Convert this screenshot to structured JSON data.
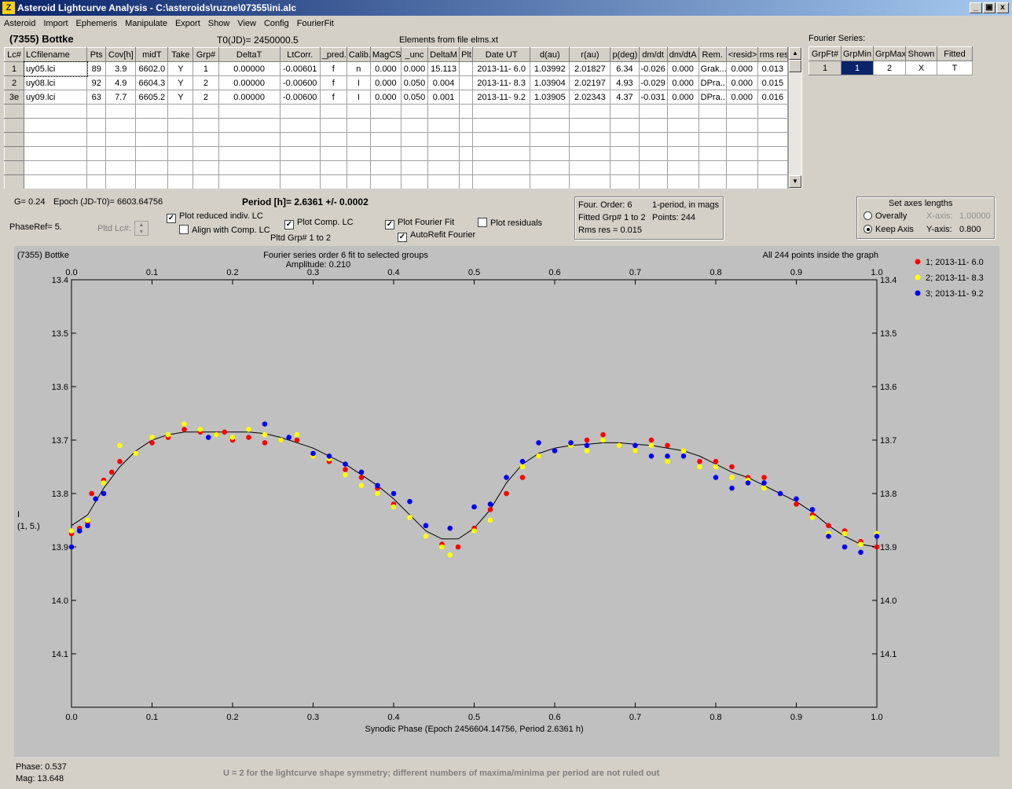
{
  "window": {
    "title": "Asteroid Lightcurve Analysis - C:\\asteroids\\ruzne\\07355\\ini.alc",
    "min": "_",
    "max": "×",
    "close": "x"
  },
  "menu": [
    "Asteroid",
    "Import",
    "Ephemeris",
    "Manipulate",
    "Export",
    "Show",
    "View",
    "Config",
    "FourierFit"
  ],
  "header": {
    "asteroid": "(7355) Bottke",
    "t0": "T0(JD)= 2450000.5",
    "elements": "Elements from file elms.xt"
  },
  "table": {
    "columns": [
      "Lc#",
      "LCfilename",
      "Pts",
      "Cov[h]",
      "midT",
      "Take",
      "Grp#",
      "DeltaT",
      "LtCorr.",
      "_pred.",
      "Calib.",
      "MagCS",
      "_unc",
      "DeltaM",
      "Plt",
      "Date UT",
      "d(au)",
      "r(au)",
      "p(deg)",
      "dm/dt",
      "dm/dtA",
      "Rem.",
      "<resid>",
      "rms res"
    ],
    "rows": [
      [
        "1",
        "uy05.lci",
        "89",
        "3.9",
        "6602.0",
        "Y",
        "1",
        "0.00000",
        "-0.00601",
        "f",
        "n",
        "0.000",
        "0.000",
        "15.113",
        "",
        "2013-11- 6.0",
        "1.03992",
        "2.01827",
        "6.34",
        "-0.026",
        "0.000",
        "Grak...",
        "0.000",
        "0.013"
      ],
      [
        "2",
        "uy08.lci",
        "92",
        "4.9",
        "6604.3",
        "Y",
        "2",
        "0.00000",
        "-0.00600",
        "f",
        "I",
        "0.000",
        "0.050",
        "0.004",
        "",
        "2013-11- 8.3",
        "1.03904",
        "2.02197",
        "4.93",
        "-0.029",
        "0.000",
        "DPra...",
        "0.000",
        "0.015"
      ],
      [
        "3e",
        "uy09.lci",
        "63",
        "7.7",
        "6605.2",
        "Y",
        "2",
        "0.00000",
        "-0.00600",
        "f",
        "I",
        "0.000",
        "0.050",
        "0.001",
        "",
        "2013-11- 9.2",
        "1.03905",
        "2.02343",
        "4.37",
        "-0.031",
        "0.000",
        "DPra...",
        "0.000",
        "0.016"
      ]
    ]
  },
  "fourier_series": {
    "label": "Fourier Series:",
    "columns": [
      "GrpFt#",
      "GrpMin",
      "GrpMax",
      "Shown",
      "Fitted"
    ],
    "row": [
      "1",
      "1",
      "2",
      "X",
      "T"
    ]
  },
  "info": {
    "g": "G= 0.24",
    "epoch": "Epoch (JD-T0)= 6603.64756",
    "period": "Period [h]= 2.6361 +/- 0.0002",
    "phaseref": "PhaseRef= 5.",
    "pltd_lc": "Pltd Lc#:",
    "pltd_grp": "Pltd Grp#  1   to   2"
  },
  "options": {
    "plot_reduced": "Plot reduced indiv. LC",
    "align_comp": "Align with Comp. LC",
    "plot_comp": "Plot Comp. LC",
    "plot_fourier": "Plot Fourier Fit",
    "autorefit": "AutoRefit Fourier",
    "plot_resid": "Plot residuals"
  },
  "fitinfo": {
    "order": "Four. Order:  6",
    "period_mode": "1-period, in mags",
    "fitted": "Fitted Grp# 1 to 2",
    "points": "Points: 244",
    "rms": "Rms res     = 0.015"
  },
  "axes_panel": {
    "title": "Set axes lengths",
    "overally": "Overally",
    "keep": "Keep Axis",
    "xaxis": "X-axis:",
    "xval": "1.00000",
    "yaxis": "Y-axis:",
    "yval": "0.800"
  },
  "plot": {
    "name": "(7355) Bottke",
    "title": "Fourier series order 6 fit to selected groups",
    "amplitude": "Amplitude: 0.210",
    "inside": "All 244 points inside the graph",
    "ylabel1": "I",
    "ylabel2": "(1, 5.)",
    "xlabel": "Synodic Phase (Epoch 2456604.14756, Period 2.6361 h)"
  },
  "status": {
    "phase": "Phase:  0.537",
    "mag": "Mag:   13.648",
    "note": "U = 2 for the lightcurve shape symmetry; different numbers of maxima/minima per period are not ruled out"
  },
  "chart_data": {
    "type": "scatter",
    "title": "Fourier series order 6 fit to selected groups",
    "xlabel": "Synodic Phase (Epoch 2456604.14756, Period 2.6361 h)",
    "ylabel": "I (1, 5.)",
    "xlim": [
      0,
      1
    ],
    "ylim": [
      14.2,
      13.4
    ],
    "y_inverted": true,
    "xticks": [
      "0.0",
      "0.1",
      "0.2",
      "0.3",
      "0.4",
      "0.5",
      "0.6",
      "0.7",
      "0.8",
      "0.9",
      "1.0"
    ],
    "yticks": [
      "13.4",
      "13.5",
      "13.6",
      "13.7",
      "13.8",
      "13.9",
      "14.0",
      "14.1"
    ],
    "legend_position": "top-right",
    "fit_curve": {
      "name": "Fourier fit",
      "color": "#000000",
      "points": [
        [
          0,
          13.86
        ],
        [
          0.02,
          13.84
        ],
        [
          0.04,
          13.79
        ],
        [
          0.06,
          13.75
        ],
        [
          0.08,
          13.72
        ],
        [
          0.1,
          13.7
        ],
        [
          0.12,
          13.69
        ],
        [
          0.14,
          13.685
        ],
        [
          0.16,
          13.685
        ],
        [
          0.18,
          13.685
        ],
        [
          0.2,
          13.685
        ],
        [
          0.22,
          13.685
        ],
        [
          0.24,
          13.688
        ],
        [
          0.26,
          13.695
        ],
        [
          0.28,
          13.705
        ],
        [
          0.3,
          13.715
        ],
        [
          0.32,
          13.73
        ],
        [
          0.34,
          13.745
        ],
        [
          0.36,
          13.765
        ],
        [
          0.38,
          13.785
        ],
        [
          0.4,
          13.81
        ],
        [
          0.42,
          13.84
        ],
        [
          0.44,
          13.87
        ],
        [
          0.46,
          13.885
        ],
        [
          0.48,
          13.885
        ],
        [
          0.5,
          13.865
        ],
        [
          0.52,
          13.83
        ],
        [
          0.54,
          13.78
        ],
        [
          0.56,
          13.745
        ],
        [
          0.58,
          13.725
        ],
        [
          0.6,
          13.715
        ],
        [
          0.62,
          13.71
        ],
        [
          0.64,
          13.708
        ],
        [
          0.66,
          13.705
        ],
        [
          0.68,
          13.705
        ],
        [
          0.7,
          13.708
        ],
        [
          0.72,
          13.71
        ],
        [
          0.74,
          13.715
        ],
        [
          0.76,
          13.72
        ],
        [
          0.78,
          13.73
        ],
        [
          0.8,
          13.745
        ],
        [
          0.82,
          13.76
        ],
        [
          0.84,
          13.77
        ],
        [
          0.86,
          13.785
        ],
        [
          0.88,
          13.8
        ],
        [
          0.9,
          13.815
        ],
        [
          0.92,
          13.835
        ],
        [
          0.94,
          13.86
        ],
        [
          0.96,
          13.88
        ],
        [
          0.98,
          13.895
        ],
        [
          1.0,
          13.9
        ]
      ]
    },
    "series": [
      {
        "name": "1; 2013-11- 6.0",
        "color": "#ff0000",
        "points": [
          [
            0,
            13.875
          ],
          [
            0.01,
            13.865
          ],
          [
            0.02,
            13.855
          ],
          [
            0.025,
            13.8
          ],
          [
            0.03,
            13.81
          ],
          [
            0.04,
            13.775
          ],
          [
            0.05,
            13.76
          ],
          [
            0.06,
            13.74
          ],
          [
            0.08,
            13.725
          ],
          [
            0.1,
            13.705
          ],
          [
            0.12,
            13.695
          ],
          [
            0.14,
            13.68
          ],
          [
            0.16,
            13.685
          ],
          [
            0.18,
            13.69
          ],
          [
            0.19,
            13.685
          ],
          [
            0.2,
            13.7
          ],
          [
            0.22,
            13.695
          ],
          [
            0.24,
            13.705
          ],
          [
            0.26,
            13.7
          ],
          [
            0.28,
            13.7
          ],
          [
            0.3,
            13.73
          ],
          [
            0.32,
            13.74
          ],
          [
            0.34,
            13.755
          ],
          [
            0.36,
            13.77
          ],
          [
            0.38,
            13.79
          ],
          [
            0.4,
            13.82
          ],
          [
            0.44,
            13.86
          ],
          [
            0.46,
            13.895
          ],
          [
            0.48,
            13.9
          ],
          [
            0.5,
            13.865
          ],
          [
            0.52,
            13.83
          ],
          [
            0.54,
            13.8
          ],
          [
            0.56,
            13.77
          ],
          [
            0.58,
            13.73
          ],
          [
            0.6,
            13.72
          ],
          [
            0.62,
            13.71
          ],
          [
            0.64,
            13.7
          ],
          [
            0.66,
            13.69
          ],
          [
            0.68,
            13.71
          ],
          [
            0.7,
            13.72
          ],
          [
            0.72,
            13.7
          ],
          [
            0.74,
            13.71
          ],
          [
            0.76,
            13.72
          ],
          [
            0.78,
            13.74
          ],
          [
            0.8,
            13.74
          ],
          [
            0.82,
            13.75
          ],
          [
            0.84,
            13.77
          ],
          [
            0.86,
            13.77
          ],
          [
            0.88,
            13.8
          ],
          [
            0.9,
            13.82
          ],
          [
            0.92,
            13.84
          ],
          [
            0.94,
            13.86
          ],
          [
            0.96,
            13.87
          ],
          [
            0.98,
            13.89
          ],
          [
            1.0,
            13.9
          ]
        ]
      },
      {
        "name": "2; 2013-11- 8.3",
        "color": "#ffff00",
        "points": [
          [
            0,
            13.87
          ],
          [
            0.02,
            13.85
          ],
          [
            0.04,
            13.78
          ],
          [
            0.06,
            13.71
          ],
          [
            0.08,
            13.725
          ],
          [
            0.1,
            13.695
          ],
          [
            0.12,
            13.69
          ],
          [
            0.14,
            13.67
          ],
          [
            0.16,
            13.68
          ],
          [
            0.18,
            13.69
          ],
          [
            0.2,
            13.695
          ],
          [
            0.22,
            13.68
          ],
          [
            0.24,
            13.69
          ],
          [
            0.26,
            13.7
          ],
          [
            0.28,
            13.69
          ],
          [
            0.3,
            13.73
          ],
          [
            0.32,
            13.735
          ],
          [
            0.34,
            13.765
          ],
          [
            0.36,
            13.785
          ],
          [
            0.38,
            13.8
          ],
          [
            0.4,
            13.825
          ],
          [
            0.42,
            13.845
          ],
          [
            0.44,
            13.88
          ],
          [
            0.46,
            13.9
          ],
          [
            0.47,
            13.915
          ],
          [
            0.5,
            13.87
          ],
          [
            0.52,
            13.85
          ],
          [
            0.54,
            13.77
          ],
          [
            0.56,
            13.75
          ],
          [
            0.58,
            13.73
          ],
          [
            0.6,
            13.72
          ],
          [
            0.62,
            13.71
          ],
          [
            0.64,
            13.72
          ],
          [
            0.66,
            13.7
          ],
          [
            0.68,
            13.71
          ],
          [
            0.7,
            13.72
          ],
          [
            0.72,
            13.71
          ],
          [
            0.74,
            13.74
          ],
          [
            0.76,
            13.72
          ],
          [
            0.78,
            13.75
          ],
          [
            0.8,
            13.75
          ],
          [
            0.82,
            13.77
          ],
          [
            0.84,
            13.775
          ],
          [
            0.86,
            13.79
          ],
          [
            0.88,
            13.8
          ],
          [
            0.9,
            13.81
          ],
          [
            0.92,
            13.845
          ],
          [
            0.94,
            13.875
          ],
          [
            0.96,
            13.875
          ],
          [
            0.98,
            13.895
          ],
          [
            1.0,
            13.875
          ]
        ]
      },
      {
        "name": "3; 2013-11- 9.2",
        "color": "#0000ff",
        "points": [
          [
            0,
            13.9
          ],
          [
            0.01,
            13.87
          ],
          [
            0.02,
            13.86
          ],
          [
            0.03,
            13.81
          ],
          [
            0.04,
            13.8
          ],
          [
            0.17,
            13.695
          ],
          [
            0.24,
            13.67
          ],
          [
            0.27,
            13.695
          ],
          [
            0.3,
            13.725
          ],
          [
            0.32,
            13.73
          ],
          [
            0.34,
            13.745
          ],
          [
            0.36,
            13.76
          ],
          [
            0.38,
            13.785
          ],
          [
            0.4,
            13.8
          ],
          [
            0.42,
            13.815
          ],
          [
            0.44,
            13.86
          ],
          [
            0.47,
            13.865
          ],
          [
            0.5,
            13.825
          ],
          [
            0.52,
            13.82
          ],
          [
            0.54,
            13.77
          ],
          [
            0.56,
            13.74
          ],
          [
            0.58,
            13.705
          ],
          [
            0.6,
            13.72
          ],
          [
            0.62,
            13.705
          ],
          [
            0.64,
            13.71
          ],
          [
            0.7,
            13.71
          ],
          [
            0.72,
            13.73
          ],
          [
            0.74,
            13.73
          ],
          [
            0.76,
            13.73
          ],
          [
            0.8,
            13.77
          ],
          [
            0.82,
            13.79
          ],
          [
            0.84,
            13.78
          ],
          [
            0.86,
            13.78
          ],
          [
            0.88,
            13.8
          ],
          [
            0.9,
            13.81
          ],
          [
            0.92,
            13.83
          ],
          [
            0.94,
            13.88
          ],
          [
            0.96,
            13.9
          ],
          [
            0.98,
            13.91
          ],
          [
            1.0,
            13.88
          ]
        ]
      }
    ]
  }
}
